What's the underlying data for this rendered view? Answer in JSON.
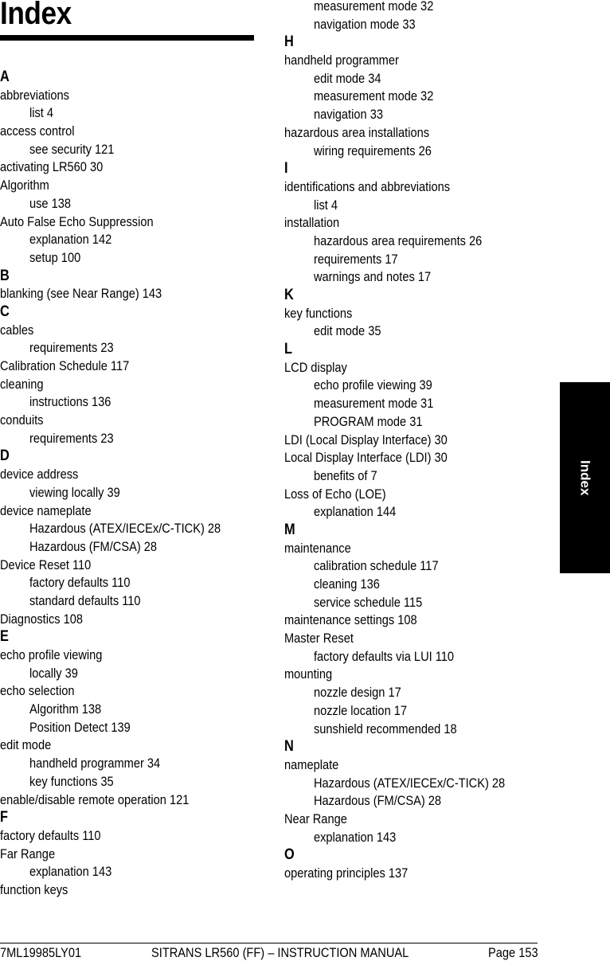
{
  "page": {
    "title": "Index",
    "side_tab": "Index"
  },
  "columns": [
    [
      {
        "type": "letter",
        "text": "A"
      },
      {
        "type": "entry",
        "text": "abbreviations"
      },
      {
        "type": "sub",
        "text": "list 4"
      },
      {
        "type": "entry",
        "text": "access control"
      },
      {
        "type": "sub",
        "text": "see security 121"
      },
      {
        "type": "entry",
        "text": "activating LR560 30"
      },
      {
        "type": "entry",
        "text": "Algorithm"
      },
      {
        "type": "sub",
        "text": "use 138"
      },
      {
        "type": "entry",
        "text": "Auto False Echo Suppression"
      },
      {
        "type": "sub",
        "text": "explanation 142"
      },
      {
        "type": "sub",
        "text": "setup 100"
      },
      {
        "type": "letter",
        "text": "B"
      },
      {
        "type": "entry",
        "text": "blanking (see Near Range) 143"
      },
      {
        "type": "letter",
        "text": "C"
      },
      {
        "type": "entry",
        "text": "cables"
      },
      {
        "type": "sub",
        "text": "requirements 23"
      },
      {
        "type": "entry",
        "text": "Calibration Schedule 117"
      },
      {
        "type": "entry",
        "text": "cleaning"
      },
      {
        "type": "sub",
        "text": "instructions 136"
      },
      {
        "type": "entry",
        "text": "conduits"
      },
      {
        "type": "sub",
        "text": "requirements 23"
      },
      {
        "type": "letter",
        "text": "D"
      },
      {
        "type": "entry",
        "text": "device address"
      },
      {
        "type": "sub",
        "text": "viewing locally 39"
      },
      {
        "type": "entry",
        "text": "device nameplate"
      },
      {
        "type": "sub",
        "text": "Hazardous (ATEX/IECEx/C-TICK) 28"
      },
      {
        "type": "sub",
        "text": "Hazardous (FM/CSA) 28"
      },
      {
        "type": "entry",
        "text": "Device Reset 110"
      },
      {
        "type": "sub",
        "text": "factory defaults 110"
      },
      {
        "type": "sub",
        "text": "standard defaults 110"
      },
      {
        "type": "entry",
        "text": "Diagnostics 108"
      },
      {
        "type": "letter",
        "text": "E"
      },
      {
        "type": "entry",
        "text": "echo profile viewing"
      },
      {
        "type": "sub",
        "text": "locally 39"
      },
      {
        "type": "entry",
        "text": "echo selection"
      },
      {
        "type": "sub",
        "text": "Algorithm 138"
      },
      {
        "type": "sub",
        "text": "Position Detect 139"
      },
      {
        "type": "entry",
        "text": "edit mode"
      },
      {
        "type": "sub",
        "text": "handheld programmer 34"
      },
      {
        "type": "sub",
        "text": "key functions 35"
      },
      {
        "type": "entry",
        "text": "enable/disable remote operation 121"
      },
      {
        "type": "letter",
        "text": "F"
      },
      {
        "type": "entry",
        "text": "factory defaults 110"
      },
      {
        "type": "entry",
        "text": "Far Range"
      },
      {
        "type": "sub",
        "text": "explanation 143"
      },
      {
        "type": "entry",
        "text": "function keys"
      }
    ],
    [
      {
        "type": "sub",
        "text": "measurement mode 32"
      },
      {
        "type": "sub",
        "text": "navigation mode 33"
      },
      {
        "type": "letter",
        "text": "H"
      },
      {
        "type": "entry",
        "text": "handheld programmer"
      },
      {
        "type": "sub",
        "text": "edit mode 34"
      },
      {
        "type": "sub",
        "text": "measurement mode 32"
      },
      {
        "type": "sub",
        "text": "navigation 33"
      },
      {
        "type": "entry",
        "text": "hazardous area installations"
      },
      {
        "type": "sub",
        "text": "wiring requirements 26"
      },
      {
        "type": "letter",
        "text": "I"
      },
      {
        "type": "entry",
        "text": "identifications and abbreviations"
      },
      {
        "type": "sub",
        "text": "list 4"
      },
      {
        "type": "entry",
        "text": "installation"
      },
      {
        "type": "sub",
        "text": "hazardous area requirements 26"
      },
      {
        "type": "sub",
        "text": "requirements 17"
      },
      {
        "type": "sub",
        "text": "warnings and notes 17"
      },
      {
        "type": "letter",
        "text": "K"
      },
      {
        "type": "entry",
        "text": "key functions"
      },
      {
        "type": "sub",
        "text": "edit mode 35"
      },
      {
        "type": "letter",
        "text": "L"
      },
      {
        "type": "entry",
        "text": "LCD display"
      },
      {
        "type": "sub",
        "text": "echo profile viewing 39"
      },
      {
        "type": "sub",
        "text": "measurement mode 31"
      },
      {
        "type": "sub",
        "text": "PROGRAM mode 31"
      },
      {
        "type": "entry",
        "text": "LDI (Local Display Interface) 30"
      },
      {
        "type": "entry",
        "text": "Local Display Interface (LDI) 30"
      },
      {
        "type": "sub",
        "text": "benefits of 7"
      },
      {
        "type": "entry",
        "text": "Loss of Echo (LOE)"
      },
      {
        "type": "sub",
        "text": "explanation 144"
      },
      {
        "type": "letter",
        "text": "M"
      },
      {
        "type": "entry",
        "text": "maintenance"
      },
      {
        "type": "sub",
        "text": "calibration schedule 117"
      },
      {
        "type": "sub",
        "text": "cleaning 136"
      },
      {
        "type": "sub",
        "text": "service schedule 115"
      },
      {
        "type": "entry",
        "text": "maintenance settings 108"
      },
      {
        "type": "entry",
        "text": "Master Reset"
      },
      {
        "type": "sub",
        "text": "factory defaults via LUI 110"
      },
      {
        "type": "entry",
        "text": "mounting"
      },
      {
        "type": "sub",
        "text": "nozzle design 17"
      },
      {
        "type": "sub",
        "text": "nozzle location 17"
      },
      {
        "type": "sub",
        "text": "sunshield recommended 18"
      },
      {
        "type": "letter",
        "text": "N"
      },
      {
        "type": "entry",
        "text": "nameplate"
      },
      {
        "type": "sub",
        "text": "Hazardous (ATEX/IECEx/C-TICK) 28"
      },
      {
        "type": "sub",
        "text": "Hazardous (FM/CSA) 28"
      },
      {
        "type": "entry",
        "text": "Near Range"
      },
      {
        "type": "sub",
        "text": "explanation 143"
      },
      {
        "type": "letter",
        "text": "O"
      },
      {
        "type": "entry",
        "text": "operating principles 137"
      }
    ]
  ],
  "footer": {
    "doc_number": "7ML19985LY01",
    "manual_title": "SITRANS LR560 (FF) – INSTRUCTION MANUAL",
    "page_label": "Page 153"
  }
}
